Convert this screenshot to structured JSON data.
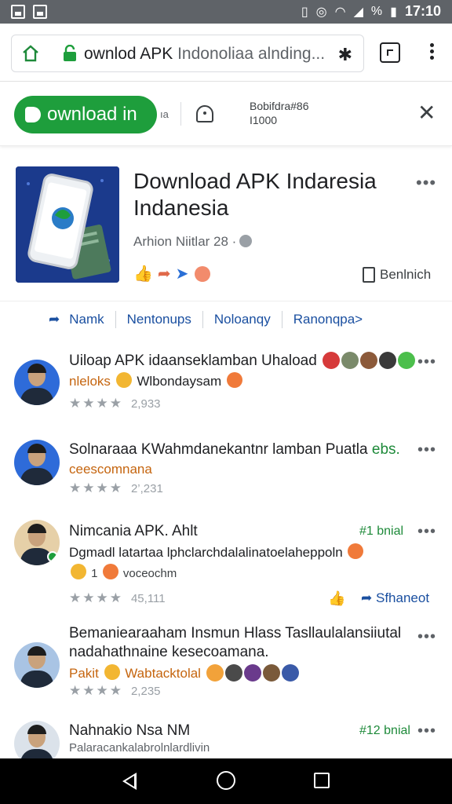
{
  "status_bar": {
    "time": "17:10",
    "battery_text": "%"
  },
  "url_bar": {
    "url_text": "ownlod APK",
    "url_text_dim": "Indonoliaa alnding...",
    "home_icon": "home-icon",
    "lock_icon": "lock-icon",
    "pin_icon": "pin-icon"
  },
  "banner": {
    "download_label": "ownload in",
    "small_text": "ıa",
    "meta_line1": "Bobifdra#86",
    "meta_line2": "I1000"
  },
  "app": {
    "name": "Download APK Indaresia Indanesia",
    "author": "Arhion Niitlar 28 ·",
    "action_label": "Benlnich"
  },
  "tabs": [
    "Namk",
    "Nentonups",
    "Noloanqy",
    "Ranonqpa>"
  ],
  "feed": [
    {
      "title": "Uiloap APK idaanseklamban Uhaload",
      "sub_orange": "nleloks",
      "sub_text": "Wlbondaysam",
      "count": "2,933"
    },
    {
      "title": "Solnaraaa KWahmdanekantnr lamban Puatla",
      "title_green": "ebs.",
      "sub_orange": "ceescomnana",
      "count": "2’,231"
    },
    {
      "title": "Nimcania APK. Ahlt",
      "tag": "#1 bnial",
      "line2": "Dgmadl latartaa lphclarchdalalinatoelaheppoln",
      "line3_num": "1",
      "line3_text": "voceochm",
      "count": "45,111",
      "share_label": "Sfhaneot"
    },
    {
      "title": "Bemaniearaaham Insmun Hlass Tasllaulalansiiutal",
      "title2": "nadahathnaine kesecoamana.",
      "sub_orange": "Pakit",
      "sub_text": "Wabtacktolal",
      "count": "2,235"
    },
    {
      "title": "Nahnakio Nsa NM",
      "tag": "#12 bnial",
      "sub_text": "Palaracankalabrolnlardlivin"
    }
  ],
  "colors": {
    "brand_green": "#1e9e3c",
    "link_blue": "#1a4fa0",
    "app_icon_bg": "#1b3a8c"
  }
}
